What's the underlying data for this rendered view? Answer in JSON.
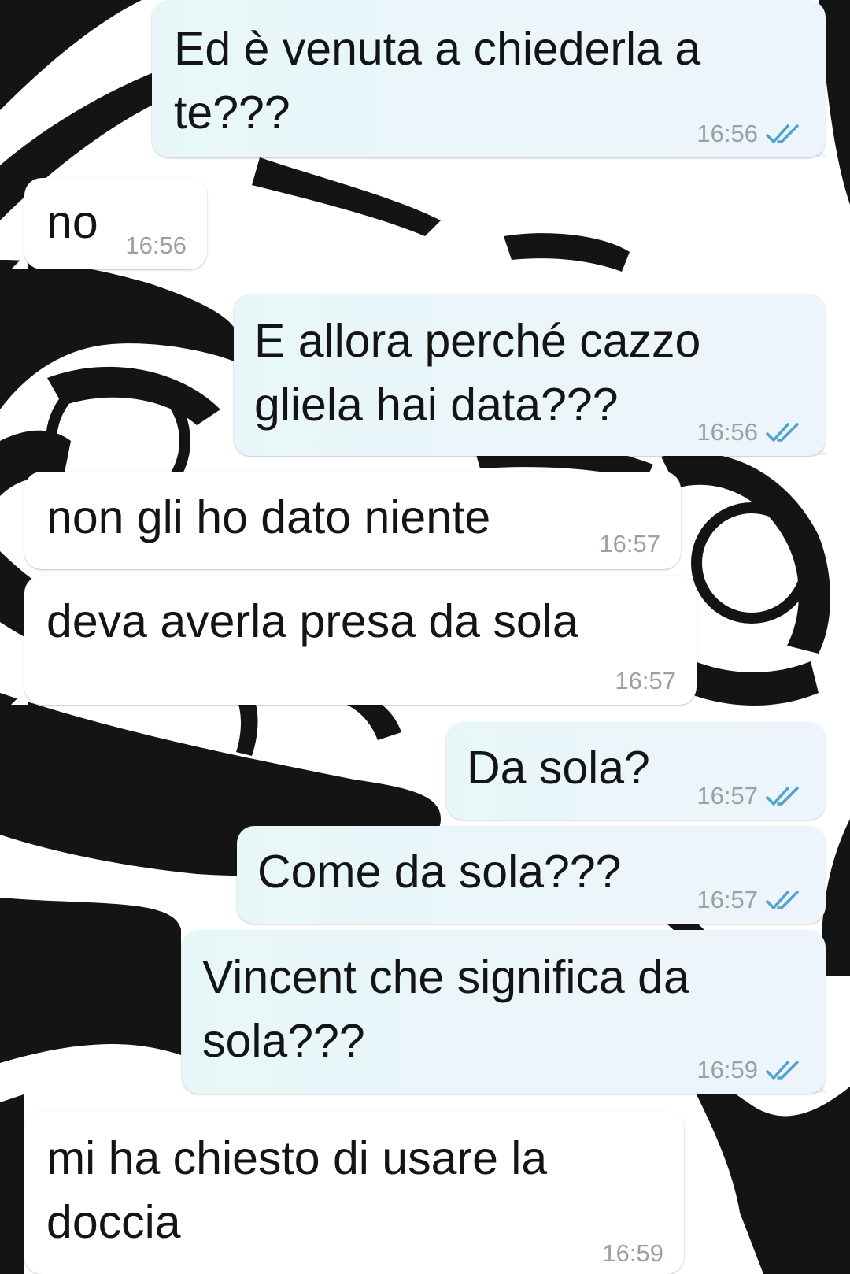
{
  "chat": {
    "messages": [
      {
        "dir": "out",
        "text": "Ed è venuta a chiederla a\nte???",
        "time": "16:56",
        "status_icon": "double-check-icon"
      },
      {
        "dir": "in",
        "text": "no",
        "time": "16:56"
      },
      {
        "dir": "out",
        "text": "E allora perché cazzo\ngliela hai data???",
        "time": "16:56",
        "status_icon": "double-check-icon"
      },
      {
        "dir": "in",
        "text": "non gli ho dato niente",
        "time": "16:57"
      },
      {
        "dir": "in",
        "text": "deva averla presa da sola",
        "time": "16:57"
      },
      {
        "dir": "out",
        "text": "Da sola?",
        "time": "16:57",
        "status_icon": "double-check-icon"
      },
      {
        "dir": "out",
        "text": "Come da sola???",
        "time": "16:57",
        "status_icon": "double-check-icon"
      },
      {
        "dir": "out",
        "text": "Vincent che significa da\nsola???",
        "time": "16:59",
        "status_icon": "double-check-icon"
      },
      {
        "dir": "in",
        "text": "mi ha chiesto di usare la\ndoccia",
        "time": "16:59"
      }
    ]
  },
  "colors": {
    "incoming_bubble": "#ffffff",
    "outgoing_bubble": "#e9f6f8",
    "tick": "#4fa3d1",
    "timestamp": "#9aa0a5",
    "wallpaper_ink": "#141414"
  }
}
